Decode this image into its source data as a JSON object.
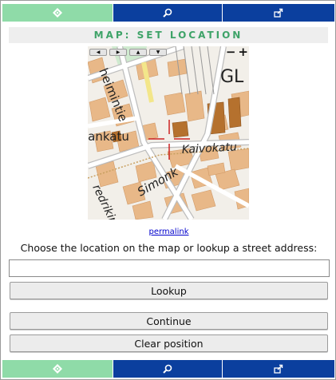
{
  "nav": {
    "home_icon": "home-diamond-icon",
    "search_icon": "magnifier-icon",
    "share_icon": "share-export-icon",
    "colors": {
      "home": "#8fdba8",
      "search": "#0b3f9e",
      "share": "#0b3f9e"
    }
  },
  "page": {
    "title": "MAP: SET LOCATION",
    "title_color": "#3ea368"
  },
  "map": {
    "pan_left": "◀",
    "pan_right": "▶",
    "pan_up": "▲",
    "pan_down": "▼",
    "zoom_out": "−",
    "zoom_in": "+",
    "streets": [
      "heimintie",
      "iankatu",
      "Kaivokatu",
      "Simonk",
      "redrikin",
      "GL"
    ]
  },
  "permalink": "permalink",
  "instruction": "Choose the location on the map or lookup a street address:",
  "address": {
    "value": "",
    "placeholder": ""
  },
  "buttons": {
    "lookup": "Lookup",
    "continue": "Continue",
    "clear": "Clear position"
  }
}
